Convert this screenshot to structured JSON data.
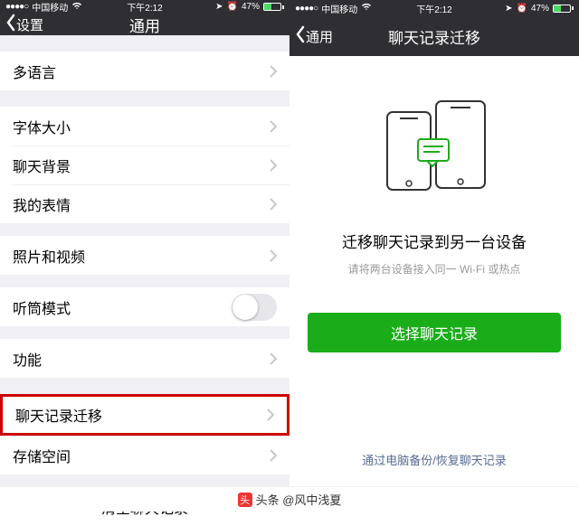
{
  "statusbar": {
    "carrier": "中国移动",
    "time": "下午2:12",
    "battery_pct": "47%"
  },
  "left": {
    "back": "设置",
    "title": "通用",
    "rows": {
      "lang": "多语言",
      "font": "字体大小",
      "bg": "聊天背景",
      "stickers": "我的表情",
      "photos": "照片和视频",
      "earpiece": "听筒模式",
      "features": "功能",
      "migrate": "聊天记录迁移",
      "storage": "存储空间",
      "clear": "清空聊天记录"
    }
  },
  "right": {
    "back": "通用",
    "title": "聊天记录迁移",
    "heading": "迁移聊天记录到另一台设备",
    "sub": "请将两台设备接入同一 Wi-Fi 或热点",
    "button": "选择聊天记录",
    "link": "通过电脑备份/恢复聊天记录"
  },
  "footer": "头条 @风中浅夏",
  "colors": {
    "accent": "#1aad19",
    "highlight": "#c00"
  }
}
